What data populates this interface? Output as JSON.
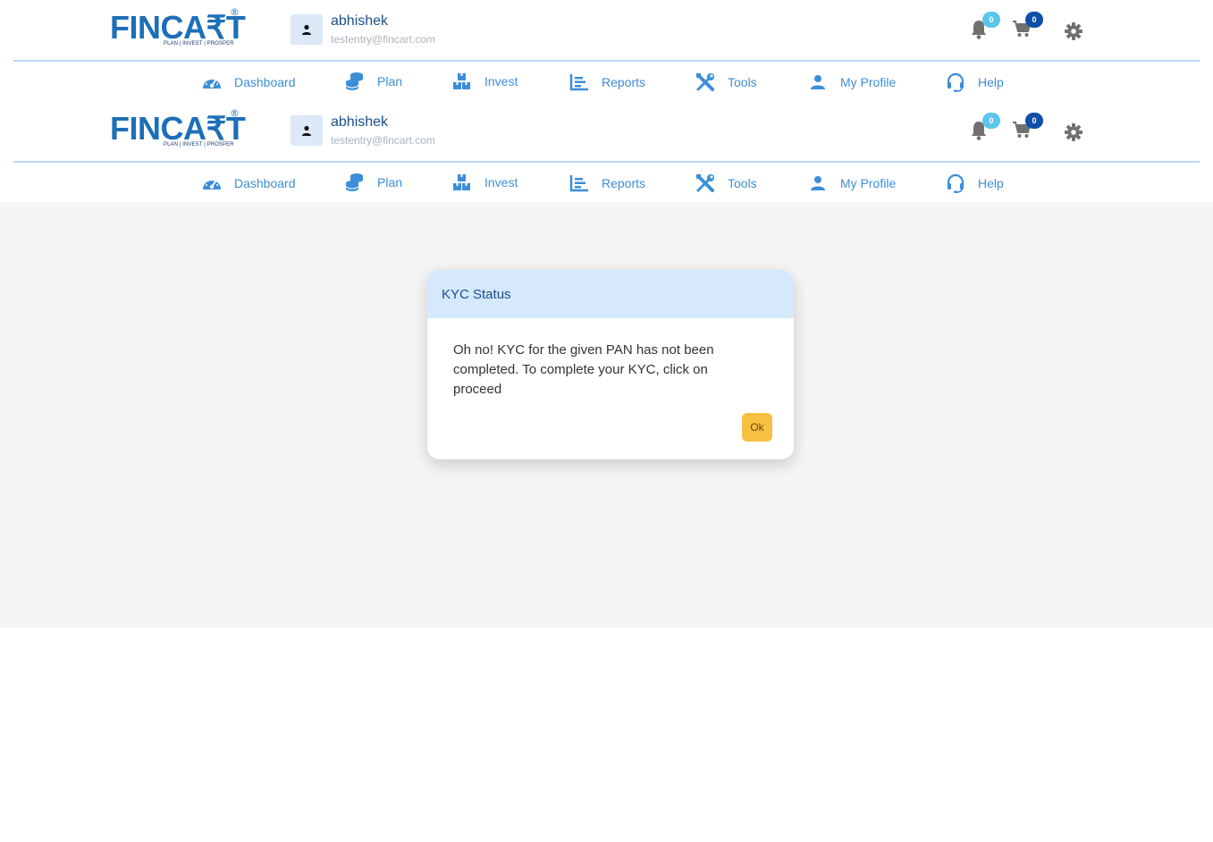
{
  "brand": {
    "logo_text": "FINCA₹T",
    "logo_tagline": "PLAN | INVEST | PROSPER",
    "registered_mark": "®"
  },
  "user": {
    "name": "abhishek",
    "email": "testentry@fincart.com"
  },
  "header_icons": {
    "notifications_count": "0",
    "cart_count": "0"
  },
  "nav": {
    "dashboard": "Dashboard",
    "plan": "Plan",
    "invest": "Invest",
    "reports": "Reports",
    "tools": "Tools",
    "my_profile": "My Profile",
    "help": "Help"
  },
  "modal": {
    "title": "KYC Status",
    "message": "Oh no! KYC for the given PAN has not been completed. To complete your KYC, click on proceed",
    "ok_label": "Ok"
  },
  "colors": {
    "accent_blue": "#3c8ed8",
    "brand_blue": "#1d6fb8",
    "modal_header": "#d6e8fb",
    "ok_button": "#f7c041",
    "notif_badge": "#5bc6ec",
    "cart_badge": "#0f4fa8"
  }
}
